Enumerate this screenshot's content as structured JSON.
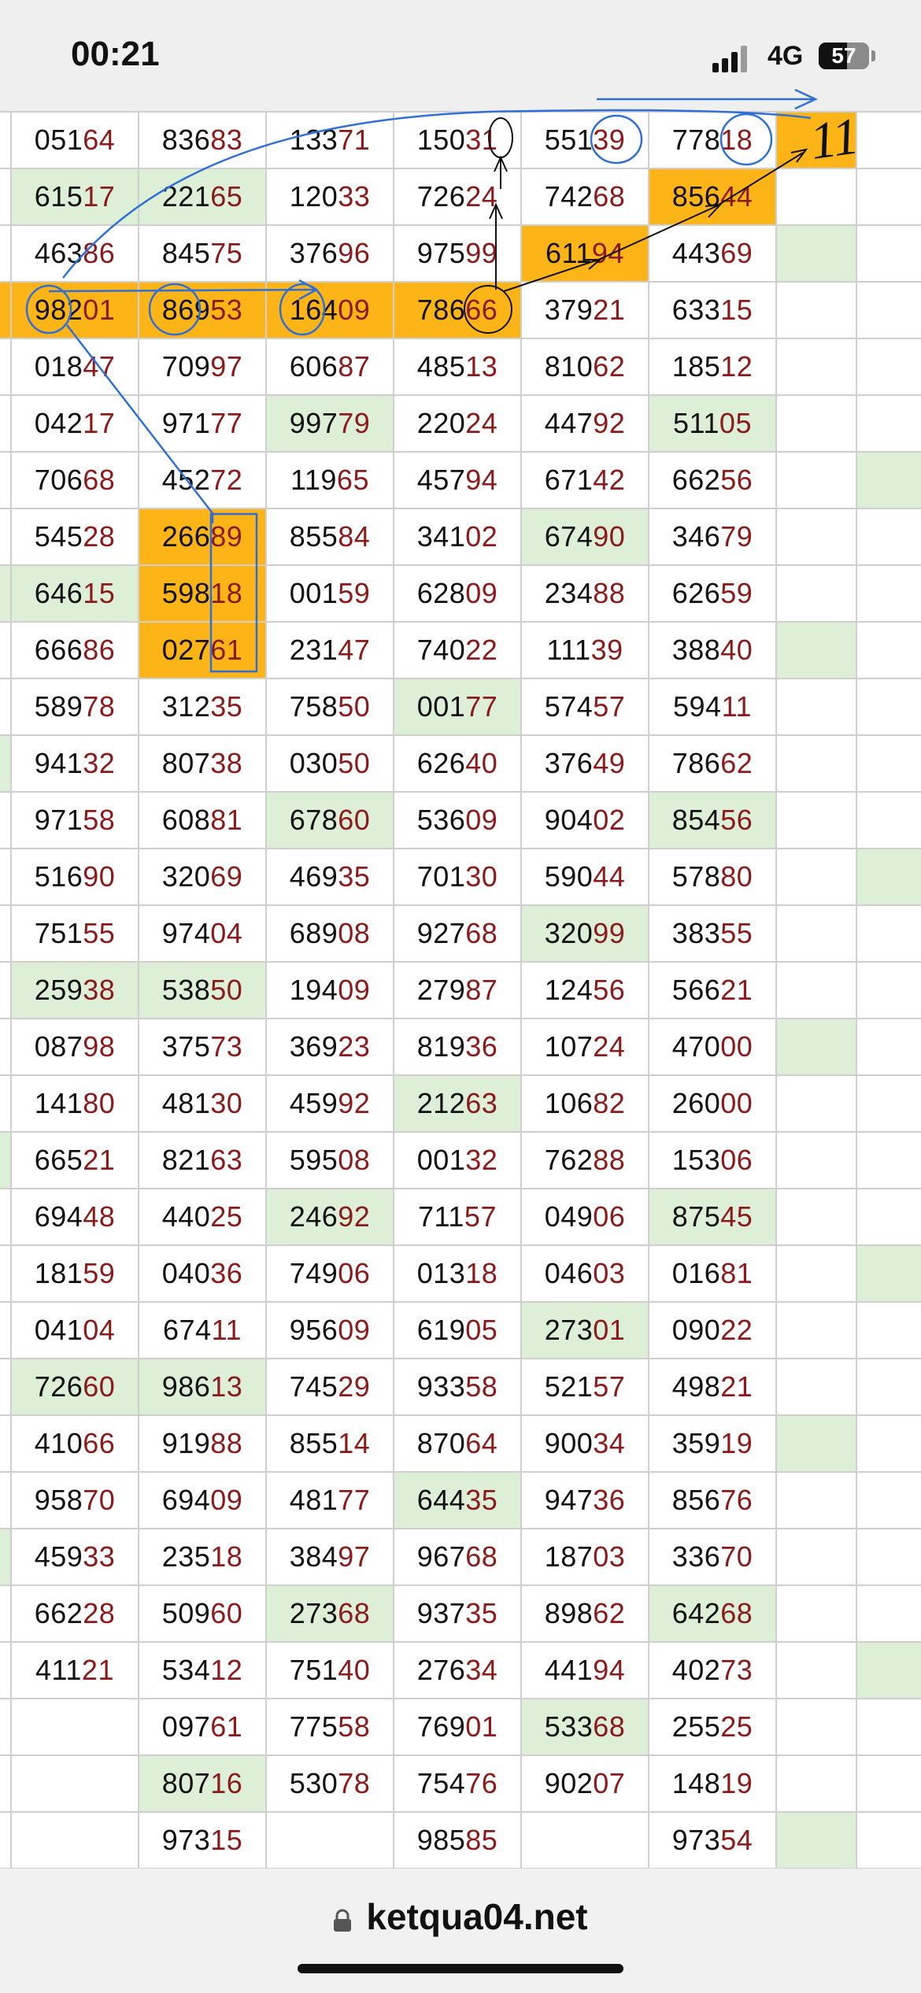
{
  "status_bar": {
    "time": "00:21",
    "network": "4G",
    "battery_level": "57"
  },
  "table": {
    "rows": [
      [
        "",
        "05164",
        "83683",
        "13371",
        "15031",
        "55139",
        "77818",
        "",
        ""
      ],
      [
        "",
        "61517",
        "22165",
        "12033",
        "72624",
        "74268",
        "85644",
        "",
        ""
      ],
      [
        "",
        "46386",
        "84575",
        "37696",
        "97599",
        "61194",
        "44369",
        "",
        ""
      ],
      [
        "",
        "98201",
        "86953",
        "16409",
        "78666",
        "37921",
        "63315",
        "",
        ""
      ],
      [
        "",
        "01847",
        "70997",
        "60687",
        "48513",
        "81062",
        "18512",
        "",
        ""
      ],
      [
        "",
        "04217",
        "97177",
        "99779",
        "22024",
        "44792",
        "51105",
        "",
        ""
      ],
      [
        "",
        "70668",
        "45272",
        "11965",
        "45794",
        "67142",
        "66256",
        "",
        ""
      ],
      [
        "",
        "54528",
        "26689",
        "85584",
        "34102",
        "67490",
        "34679",
        "",
        ""
      ],
      [
        "",
        "64615",
        "59818",
        "00159",
        "62809",
        "23488",
        "62659",
        "",
        ""
      ],
      [
        "",
        "66686",
        "02761",
        "23147",
        "74022",
        "11139",
        "38840",
        "",
        ""
      ],
      [
        "",
        "58978",
        "31235",
        "75850",
        "00177",
        "57457",
        "59411",
        "",
        ""
      ],
      [
        "",
        "94132",
        "80738",
        "03050",
        "62640",
        "37649",
        "78662",
        "",
        ""
      ],
      [
        "",
        "97158",
        "60881",
        "67860",
        "53609",
        "90402",
        "85456",
        "",
        ""
      ],
      [
        "",
        "51690",
        "32069",
        "46935",
        "70130",
        "59044",
        "57880",
        "",
        ""
      ],
      [
        "",
        "75155",
        "97404",
        "68908",
        "92768",
        "32099",
        "38355",
        "",
        ""
      ],
      [
        "",
        "25938",
        "53850",
        "19409",
        "27987",
        "12456",
        "56621",
        "",
        ""
      ],
      [
        "",
        "08798",
        "37573",
        "36923",
        "81936",
        "10724",
        "47000",
        "",
        ""
      ],
      [
        "",
        "14180",
        "48130",
        "45992",
        "21263",
        "10682",
        "26000",
        "",
        ""
      ],
      [
        "",
        "66521",
        "82163",
        "59508",
        "00132",
        "76288",
        "15306",
        "",
        ""
      ],
      [
        "",
        "69448",
        "44025",
        "24692",
        "71157",
        "04906",
        "87545",
        "",
        ""
      ],
      [
        "",
        "18159",
        "04036",
        "74906",
        "01318",
        "04603",
        "01681",
        "",
        ""
      ],
      [
        "",
        "04104",
        "67411",
        "95609",
        "61905",
        "27301",
        "09022",
        "",
        ""
      ],
      [
        "",
        "72660",
        "98613",
        "74529",
        "93358",
        "52157",
        "49821",
        "",
        ""
      ],
      [
        "",
        "41066",
        "91988",
        "85514",
        "87064",
        "90034",
        "35919",
        "",
        ""
      ],
      [
        "",
        "95870",
        "69409",
        "48177",
        "64435",
        "94736",
        "85676",
        "",
        ""
      ],
      [
        "",
        "45933",
        "23518",
        "38497",
        "96768",
        "18703",
        "33670",
        "",
        ""
      ],
      [
        "",
        "66228",
        "50960",
        "27368",
        "93735",
        "89862",
        "64268",
        "",
        ""
      ],
      [
        "",
        "41121",
        "53412",
        "75140",
        "27634",
        "44194",
        "40273",
        "",
        ""
      ],
      [
        "",
        "",
        "09761",
        "77558",
        "76901",
        "53368",
        "25525",
        "",
        ""
      ],
      [
        "",
        "",
        "80716",
        "53078",
        "75476",
        "90207",
        "14819",
        "",
        ""
      ],
      [
        "",
        "",
        "97315",
        "",
        "98585",
        "",
        "97354",
        "",
        ""
      ]
    ],
    "green_cells": [
      [
        1,
        1
      ],
      [
        1,
        2
      ],
      [
        2,
        7
      ],
      [
        5,
        3
      ],
      [
        5,
        6
      ],
      [
        6,
        8
      ],
      [
        7,
        5
      ],
      [
        8,
        1
      ],
      [
        8,
        0
      ],
      [
        9,
        7
      ],
      [
        10,
        4
      ],
      [
        11,
        0
      ],
      [
        12,
        3
      ],
      [
        12,
        6
      ],
      [
        13,
        8
      ],
      [
        14,
        5
      ],
      [
        15,
        1
      ],
      [
        15,
        2
      ],
      [
        16,
        7
      ],
      [
        17,
        4
      ],
      [
        18,
        0
      ],
      [
        19,
        3
      ],
      [
        19,
        6
      ],
      [
        20,
        8
      ],
      [
        21,
        5
      ],
      [
        22,
        1
      ],
      [
        22,
        2
      ],
      [
        23,
        7
      ],
      [
        24,
        4
      ],
      [
        25,
        0
      ],
      [
        26,
        3
      ],
      [
        26,
        6
      ],
      [
        27,
        8
      ],
      [
        28,
        5
      ],
      [
        29,
        2
      ],
      [
        30,
        7
      ]
    ],
    "orange_cells": [
      [
        0,
        7
      ],
      [
        1,
        6
      ],
      [
        2,
        5
      ],
      [
        3,
        0
      ],
      [
        3,
        1
      ],
      [
        3,
        2
      ],
      [
        3,
        3
      ],
      [
        3,
        4
      ],
      [
        7,
        2
      ],
      [
        8,
        2
      ],
      [
        9,
        2
      ]
    ],
    "colors": {
      "tail_digits": "#8b1a1a",
      "highlight_orange": "#fcb416",
      "highlight_green": "#deefd8",
      "annotation_blue": "#2f6fd6"
    }
  },
  "annotations": {
    "handwritten_number": "11"
  },
  "footer": {
    "url": "ketqua04.net",
    "lock_icon": "lock-icon"
  }
}
